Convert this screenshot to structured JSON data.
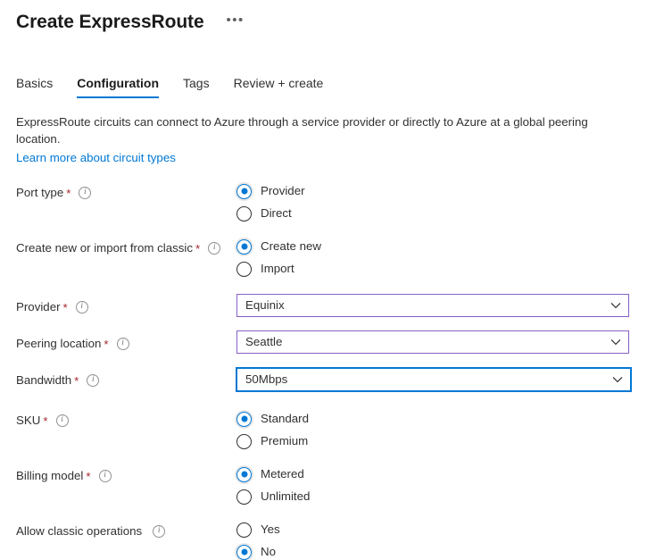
{
  "header": {
    "title": "Create ExpressRoute",
    "menu_label": "•••"
  },
  "tabs": [
    {
      "label": "Basics",
      "active": false
    },
    {
      "label": "Configuration",
      "active": true
    },
    {
      "label": "Tags",
      "active": false
    },
    {
      "label": "Review + create",
      "active": false
    }
  ],
  "description": {
    "text": "ExpressRoute circuits can connect to Azure through a service provider or directly to Azure at a global peering location.",
    "link_text": "Learn more about circuit types"
  },
  "colors": {
    "accent_blue": "#0078d4",
    "dropdown_purple": "#8661c5",
    "required_red": "#a4262c",
    "link_blue": "#0078d4"
  },
  "form": {
    "port_type": {
      "label": "Port type",
      "required_marker": "*",
      "info_icon": "info-icon",
      "options": [
        {
          "label": "Provider",
          "selected": true
        },
        {
          "label": "Direct",
          "selected": false
        }
      ]
    },
    "create_or_import": {
      "label": "Create new or import from classic",
      "required_marker": "*",
      "info_icon": "info-icon",
      "options": [
        {
          "label": "Create new",
          "selected": true
        },
        {
          "label": "Import",
          "selected": false
        }
      ]
    },
    "provider": {
      "label": "Provider",
      "required_marker": "*",
      "info_icon": "info-icon",
      "value": "Equinix",
      "chevron_icon": "chevron-down-icon"
    },
    "peering_location": {
      "label": "Peering location",
      "required_marker": "*",
      "info_icon": "info-icon",
      "value": "Seattle",
      "chevron_icon": "chevron-down-icon"
    },
    "bandwidth": {
      "label": "Bandwidth",
      "required_marker": "*",
      "info_icon": "info-icon",
      "value": "50Mbps",
      "chevron_icon": "chevron-down-icon"
    },
    "sku": {
      "label": "SKU",
      "required_marker": "*",
      "info_icon": "info-icon",
      "options": [
        {
          "label": "Standard",
          "selected": true
        },
        {
          "label": "Premium",
          "selected": false
        }
      ]
    },
    "billing_model": {
      "label": "Billing model",
      "required_marker": "*",
      "info_icon": "info-icon",
      "options": [
        {
          "label": "Metered",
          "selected": true
        },
        {
          "label": "Unlimited",
          "selected": false
        }
      ]
    },
    "allow_classic_operations": {
      "label": "Allow classic operations",
      "required_marker": "",
      "info_icon": "info-icon",
      "options": [
        {
          "label": "Yes",
          "selected": false
        },
        {
          "label": "No",
          "selected": true
        }
      ]
    }
  }
}
